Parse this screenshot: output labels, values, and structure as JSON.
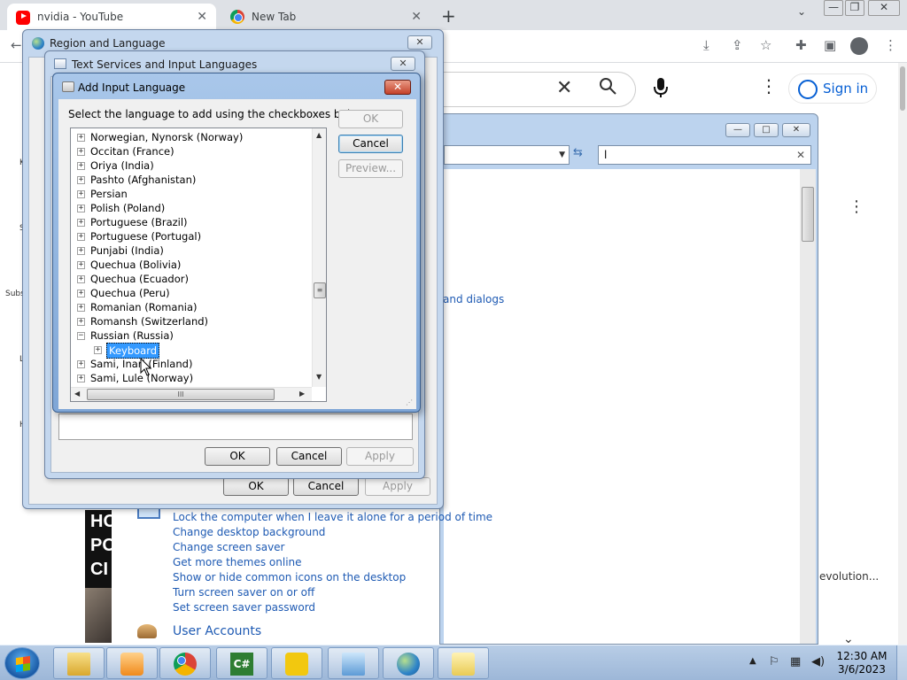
{
  "browser": {
    "tabs": [
      {
        "label": "nvidia - YouTube",
        "close": "✕"
      },
      {
        "label": "New Tab",
        "close": "✕"
      }
    ],
    "new_tab": "+",
    "window_controls": {
      "chevron": "⌄",
      "minimize": "—",
      "restore": "❐",
      "close": "✕"
    }
  },
  "youtube": {
    "clear": "✕",
    "more": "⋮",
    "sign_in": "Sign in",
    "card_more": "⋮",
    "left_letters": [
      "K",
      "S",
      "Subs",
      "L",
      "H"
    ],
    "thumbnail_text": [
      "HO",
      "PO",
      "CI"
    ],
    "video_title_tail": "evolution...",
    "sidebar_label": "nts",
    "sidebar_chevron": "⌄"
  },
  "control_panel": {
    "search_value": "l",
    "search_clear": "✕",
    "links_top": "and dialogs",
    "links": [
      "Lock the computer when I leave it alone for a period of time",
      "Change desktop background",
      "Change screen saver",
      "Get more themes online",
      "Show or hide common icons on the desktop",
      "Turn screen saver on or off",
      "Set screen saver password"
    ],
    "user_accounts": "User Accounts"
  },
  "region_dialog": {
    "title": "Region and Language",
    "close": "✕",
    "ok": "OK",
    "cancel": "Cancel",
    "apply": "Apply"
  },
  "text_services_dialog": {
    "title": "Text Services and Input Languages",
    "close": "✕",
    "ok": "OK",
    "cancel": "Cancel",
    "apply": "Apply"
  },
  "add_input_dialog": {
    "title": "Add Input Language",
    "close": "✕",
    "instruction": "Select the language to add using the checkboxes below.",
    "ok": "OK",
    "cancel": "Cancel",
    "preview": "Preview...",
    "tree": [
      {
        "label": "Norwegian, Nynorsk (Norway)",
        "expander": "+"
      },
      {
        "label": "Occitan (France)",
        "expander": "+"
      },
      {
        "label": "Oriya (India)",
        "expander": "+"
      },
      {
        "label": "Pashto (Afghanistan)",
        "expander": "+"
      },
      {
        "label": "Persian",
        "expander": "+"
      },
      {
        "label": "Polish (Poland)",
        "expander": "+"
      },
      {
        "label": "Portuguese (Brazil)",
        "expander": "+"
      },
      {
        "label": "Portuguese (Portugal)",
        "expander": "+"
      },
      {
        "label": "Punjabi (India)",
        "expander": "+"
      },
      {
        "label": "Quechua (Bolivia)",
        "expander": "+"
      },
      {
        "label": "Quechua (Ecuador)",
        "expander": "+"
      },
      {
        "label": "Quechua (Peru)",
        "expander": "+"
      },
      {
        "label": "Romanian (Romania)",
        "expander": "+"
      },
      {
        "label": "Romansh (Switzerland)",
        "expander": "+"
      },
      {
        "label": "Russian (Russia)",
        "expander": "−"
      },
      {
        "label": "Keyboard",
        "expander": "+"
      },
      {
        "label": "Sami, Inari (Finland)",
        "expander": "+"
      },
      {
        "label": "Sami, Lule (Norway)",
        "expander": "+"
      }
    ],
    "scroll_grip": "≡",
    "hscroll_grip": "III"
  },
  "taskbar": {
    "time": "12:30 AM",
    "date": "3/6/2023",
    "tray_arrow": "▲",
    "buttons": [
      "explorer",
      "media-player",
      "chrome",
      "csharp-editor",
      "app-yellow",
      "control-panel",
      "globe",
      "keyboard"
    ]
  },
  "colors": {
    "yt_blue": "#065fd4",
    "cp_link": "#1e5ab3",
    "selection": "#3399ff"
  }
}
